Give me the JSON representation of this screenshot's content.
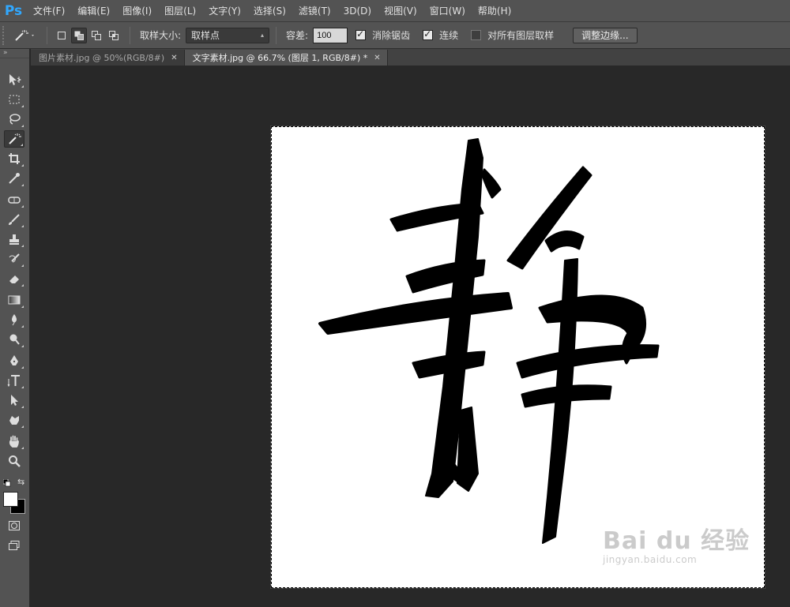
{
  "app": {
    "logo": "Ps"
  },
  "menu": [
    "文件(F)",
    "编辑(E)",
    "图像(I)",
    "图层(L)",
    "文字(Y)",
    "选择(S)",
    "滤镜(T)",
    "3D(D)",
    "视图(V)",
    "窗口(W)",
    "帮助(H)"
  ],
  "options": {
    "sample_size_label": "取样大小:",
    "sample_size_value": "取样点",
    "tolerance_label": "容差:",
    "tolerance_value": "100",
    "antialias_label": "消除锯齿",
    "antialias_checked": true,
    "contiguous_label": "连续",
    "contiguous_checked": true,
    "sample_all_layers_label": "对所有图层取样",
    "sample_all_layers_checked": false,
    "refine_edge_label": "调整边缘..."
  },
  "tabs": [
    {
      "label": "图片素材.jpg @ 50%(RGB/8#)",
      "active": false
    },
    {
      "label": "文字素材.jpg @ 66.7% (图层 1, RGB/8#) *",
      "active": true
    }
  ],
  "tools": [
    "move-icon",
    "marquee-icon",
    "lasso-icon",
    "magic-wand-icon",
    "crop-icon",
    "eyedropper-icon",
    "healing-brush-icon",
    "brush-icon",
    "clone-stamp-icon",
    "history-brush-icon",
    "eraser-icon",
    "gradient-icon",
    "blur-icon",
    "dodge-icon",
    "pen-icon",
    "type-icon",
    "path-selection-icon",
    "shape-icon",
    "hand-icon",
    "zoom-icon"
  ],
  "colors": {
    "foreground": "#ffffff",
    "background": "#000000",
    "accent": "#31a8ff"
  },
  "canvas": {
    "character": "静",
    "watermark_brand": "Bai du 经验",
    "watermark_url": "jingyan.baidu.com"
  }
}
